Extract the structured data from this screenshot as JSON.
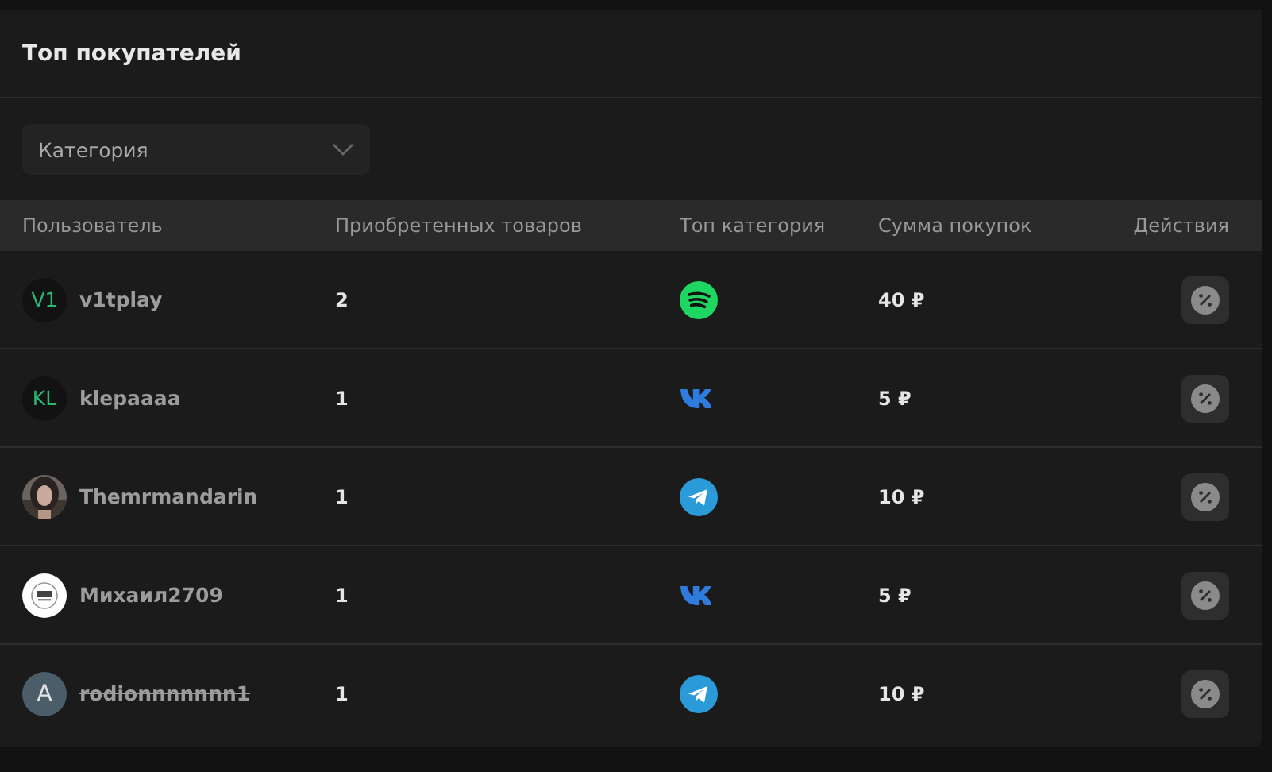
{
  "card": {
    "title": "Топ покупателей"
  },
  "filter": {
    "placeholder": "Категория"
  },
  "table": {
    "columns": [
      "Пользователь",
      "Приобретенных товаров",
      "Топ категория",
      "Сумма покупок",
      "Действия"
    ],
    "rows": [
      {
        "avatar": {
          "kind": "initials",
          "text": "V1"
        },
        "user": "v1tplay",
        "deleted": false,
        "items": "2",
        "category": {
          "kind": "spotify"
        },
        "sum": "40 ₽"
      },
      {
        "avatar": {
          "kind": "initials",
          "text": "KL"
        },
        "user": "klepaaaa",
        "deleted": false,
        "items": "1",
        "category": {
          "kind": "vk"
        },
        "sum": "5 ₽"
      },
      {
        "user": "Themrmandarin",
        "deleted": false,
        "items": "1",
        "category": {
          "kind": "telegram"
        },
        "sum": "10 ₽"
      },
      {
        "avatar": {
          "kind": "logo"
        },
        "user": "Михаил2709",
        "deleted": false,
        "items": "1",
        "category": {
          "kind": "vk"
        },
        "sum": "5 ₽"
      },
      {
        "avatar": {
          "kind": "letter",
          "text": "A"
        },
        "user": "rodionnnnnnn1",
        "deleted": true,
        "items": "1",
        "category": {
          "kind": "telegram"
        },
        "sum": "10 ₽"
      }
    ]
  }
}
